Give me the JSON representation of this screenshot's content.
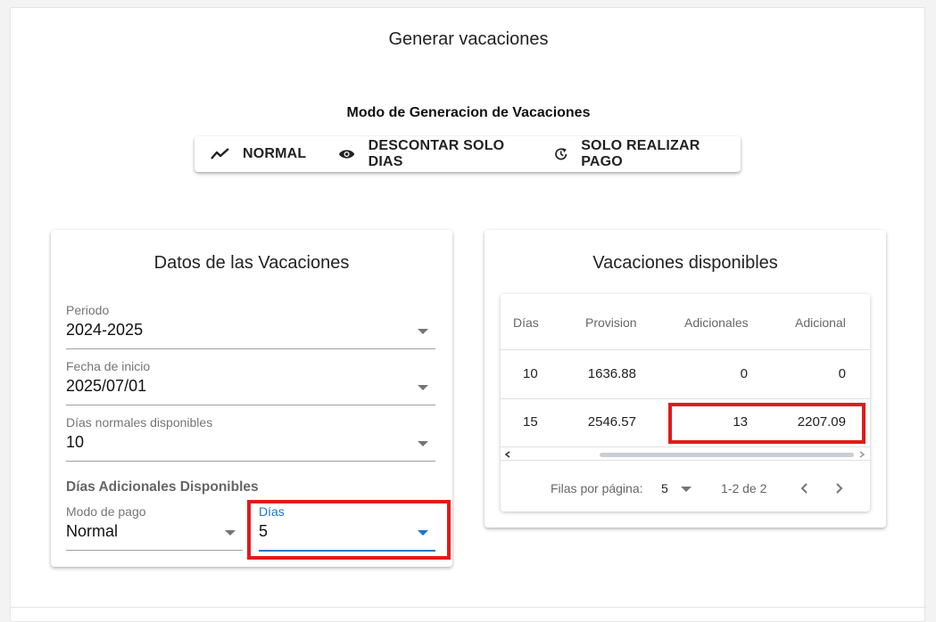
{
  "page": {
    "title": "Generar vacaciones"
  },
  "mode": {
    "title": "Modo de Generacion de Vacaciones",
    "options": [
      {
        "label": "NORMAL",
        "icon": "trending-icon"
      },
      {
        "label": "DESCONTAR SOLO DIAS",
        "icon": "eye-icon"
      },
      {
        "label": "SOLO REALIZAR PAGO",
        "icon": "history-icon"
      }
    ]
  },
  "datos": {
    "title": "Datos de las Vacaciones",
    "periodo": {
      "label": "Periodo",
      "value": "2024-2025"
    },
    "fecha": {
      "label": "Fecha de inicio",
      "value": "2025/07/01"
    },
    "dias_normales": {
      "label": "Días normales disponibles",
      "value": "10"
    },
    "adicionales_title": "Días Adicionales Disponibles",
    "modo_pago": {
      "label": "Modo de pago",
      "value": "Normal"
    },
    "dias": {
      "label": "Días",
      "value": "5"
    }
  },
  "disponibles": {
    "title": "Vacaciones disponibles",
    "headers": [
      "Días",
      "Provision",
      "Adicionales",
      "Adicional"
    ],
    "rows": [
      [
        "10",
        "1636.88",
        "0",
        "0"
      ],
      [
        "15",
        "2546.57",
        "13",
        "2207.09"
      ]
    ],
    "footer": {
      "rows_label": "Filas por página:",
      "rows_value": "5",
      "range": "1-2 de 2"
    }
  },
  "colors": {
    "accent": "#1976d2",
    "highlight": "#e01b1b"
  }
}
